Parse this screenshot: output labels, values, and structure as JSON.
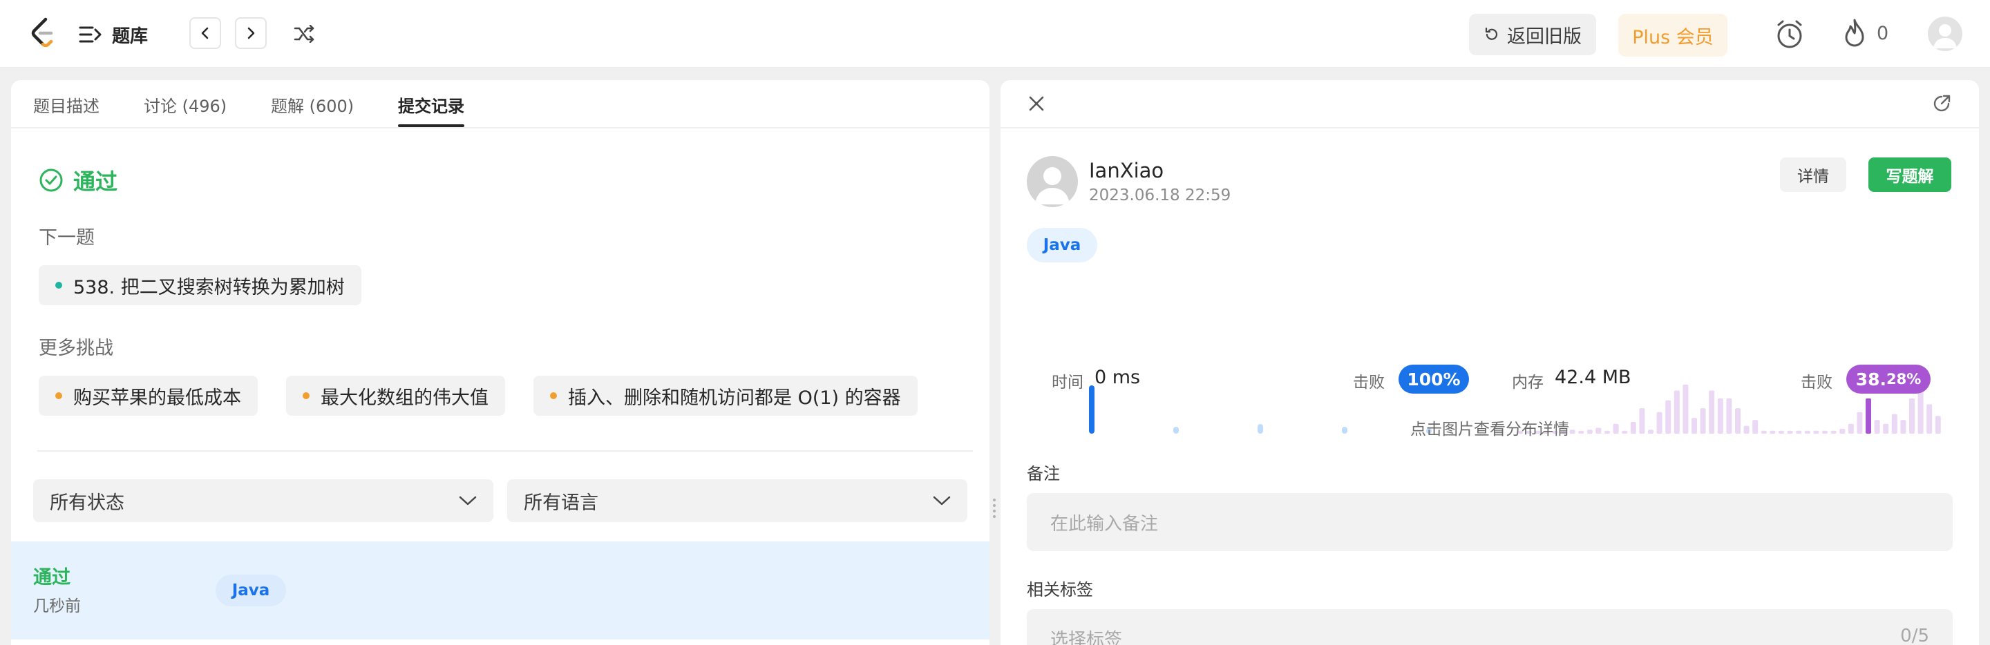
{
  "header": {
    "problem_list_label": "题库",
    "revert_label": "返回旧版",
    "plus_label": "Plus 会员",
    "streak_count": "0"
  },
  "left": {
    "tabs": [
      {
        "label": "题目描述"
      },
      {
        "label": "讨论 (496)"
      },
      {
        "label": "题解 (600)"
      },
      {
        "label": "提交记录"
      }
    ],
    "status": "通过",
    "next_label": "下一题",
    "next_problem": "538. 把二叉搜索树转换为累加树",
    "more_label": "更多挑战",
    "challenges": [
      {
        "label": "购买苹果的最低成本"
      },
      {
        "label": "最大化数组的伟大值"
      },
      {
        "label": "插入、删除和随机访问都是 O(1) 的容器"
      }
    ],
    "filters": {
      "status": "所有状态",
      "language": "所有语言"
    },
    "submissions": [
      {
        "status": "通过",
        "time": "几秒前",
        "lang": "Java"
      }
    ]
  },
  "right": {
    "user": "IanXiao",
    "date": "2023.06.18 22:59",
    "detail_label": "详情",
    "write_label": "写题解",
    "lang": "Java",
    "runtime": {
      "label": "时间",
      "value": "0 ms",
      "beat_label": "击败",
      "beat": "100%"
    },
    "memory": {
      "label": "内存",
      "value": "42.4 MB",
      "beat_label": "击败",
      "beat_int": "38.",
      "beat_frac": "28%"
    },
    "chart_hint": "点击图片查看分布详情",
    "notes_label": "备注",
    "notes_placeholder": "在此输入备注",
    "tags_label": "相关标签",
    "tags_placeholder": "选择标签",
    "tags_count": "0/5"
  },
  "colors": {
    "accepted": "#2db55d",
    "runtime_accent": "#1a73e8",
    "memory_accent": "#a855d4",
    "plus": "#f39c2d"
  },
  "icons": [
    "logo-icon",
    "list-icon",
    "chevron-left-icon",
    "chevron-right-icon",
    "shuffle-icon",
    "undo-icon",
    "alarm-icon",
    "fire-icon",
    "avatar-icon",
    "check-circle-icon",
    "chevron-down-icon",
    "close-icon",
    "external-link-icon"
  ]
}
